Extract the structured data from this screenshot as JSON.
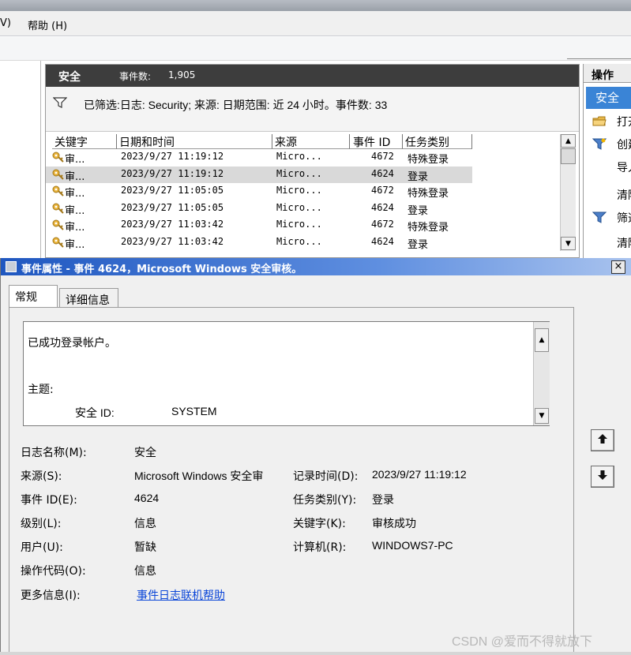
{
  "menubar": {
    "items": [
      "V)",
      "帮助 (H)"
    ]
  },
  "list_pane": {
    "title": "安全",
    "count_label": "事件数:",
    "count": "1,905",
    "filter_text": "已筛选:日志: Security; 来源: 日期范围: 近 24 小时。事件数: 33",
    "columns": [
      "关键字",
      "日期和时间",
      "来源",
      "事件 ID",
      "任务类别"
    ],
    "rows": [
      {
        "keyword": "审...",
        "datetime": "2023/9/27 11:19:12",
        "source": "Micro...",
        "event_id": "4672",
        "category": "特殊登录",
        "selected": false
      },
      {
        "keyword": "审...",
        "datetime": "2023/9/27 11:19:12",
        "source": "Micro...",
        "event_id": "4624",
        "category": "登录",
        "selected": true
      },
      {
        "keyword": "审...",
        "datetime": "2023/9/27 11:05:05",
        "source": "Micro...",
        "event_id": "4672",
        "category": "特殊登录",
        "selected": false
      },
      {
        "keyword": "审...",
        "datetime": "2023/9/27 11:05:05",
        "source": "Micro...",
        "event_id": "4624",
        "category": "登录",
        "selected": false
      },
      {
        "keyword": "审...",
        "datetime": "2023/9/27 11:03:42",
        "source": "Micro...",
        "event_id": "4672",
        "category": "特殊登录",
        "selected": false
      },
      {
        "keyword": "审...",
        "datetime": "2023/9/27 11:03:42",
        "source": "Micro...",
        "event_id": "4624",
        "category": "登录",
        "selected": false
      }
    ]
  },
  "actions_pane": {
    "title": "操作",
    "section": "安全",
    "items": [
      {
        "label": "打开",
        "icon": "folder-icon"
      },
      {
        "label": "创建",
        "icon": "filter-create-icon"
      },
      {
        "label": "导入",
        "icon": ""
      },
      {
        "label": "清除",
        "icon": ""
      },
      {
        "label": "筛选",
        "icon": "filter-icon"
      },
      {
        "label": "清除",
        "icon": ""
      }
    ]
  },
  "dialog": {
    "title": "事件属性 - 事件 4624，Microsoft Windows 安全审核。",
    "close": "×",
    "tabs": [
      "常规",
      "详细信息"
    ],
    "description": {
      "line1": "已成功登录帐户。",
      "line2": "主题:",
      "sid_label": "安全 ID:",
      "sid_value": "SYSTEM"
    },
    "fields": {
      "log_name_label": "日志名称(M):",
      "log_name": "安全",
      "source_label": "来源(S):",
      "source": "Microsoft Windows 安全审",
      "logged_label": "记录时间(D):",
      "logged": "2023/9/27 11:19:12",
      "event_id_label": "事件 ID(E):",
      "event_id": "4624",
      "task_label": "任务类别(Y):",
      "task": "登录",
      "level_label": "级别(L):",
      "level": "信息",
      "keywords_label": "关键字(K):",
      "keywords": "审核成功",
      "user_label": "用户(U):",
      "user": "暂缺",
      "computer_label": "计算机(R):",
      "computer": "WINDOWS7-PC",
      "opcode_label": "操作代码(O):",
      "opcode": "信息",
      "more_info_label": "更多信息(I):",
      "more_info_link": "事件日志联机帮助"
    }
  },
  "watermark": "CSDN @爱而不得就放下",
  "colors": {
    "header_dark": "#3d3d3d",
    "accent_blue": "#3a84d6",
    "link": "#0b46d8",
    "title_blue": "#1f57c0"
  }
}
